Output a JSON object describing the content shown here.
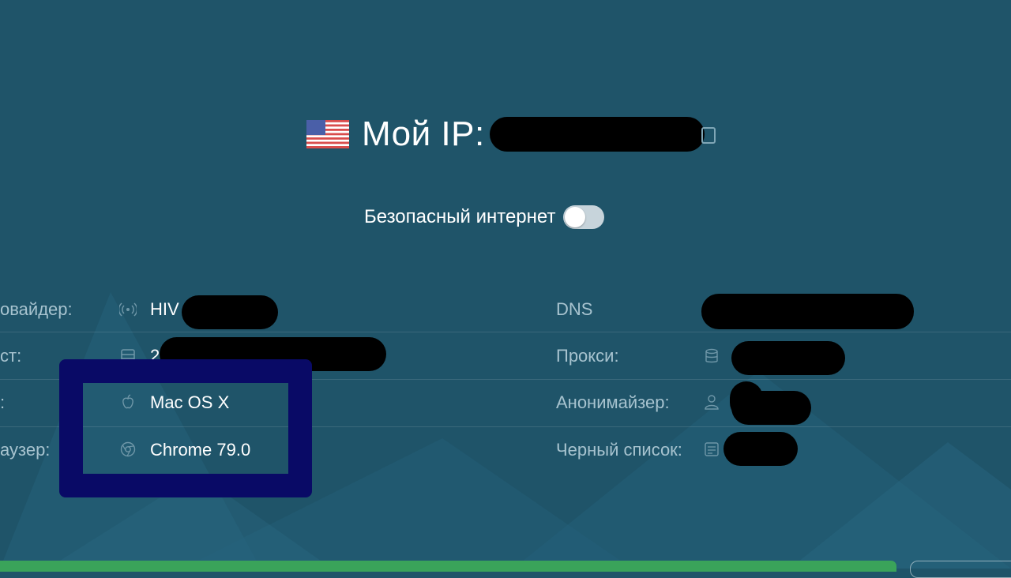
{
  "header": {
    "title": "Мой IP:"
  },
  "safe_internet": {
    "label": "Безопасный интернет",
    "enabled": false
  },
  "left_rows": [
    {
      "label": "овайдер:",
      "value": "HIV",
      "icon": "antenna-icon"
    },
    {
      "label": "ст:",
      "value": "2",
      "icon": "server-icon"
    },
    {
      "label": ":",
      "value": "Mac OS X",
      "icon": "apple-icon"
    },
    {
      "label": "аузер:",
      "value": "Chrome 79.0",
      "icon": "chrome-icon"
    }
  ],
  "right_rows": [
    {
      "label": "DNS",
      "icon": ""
    },
    {
      "label": "Прокси:",
      "icon": "database-icon"
    },
    {
      "label": "Анонимайзер:",
      "icon": "user-badge-icon"
    },
    {
      "label": "Черный список:",
      "icon": "list-icon"
    }
  ],
  "colors": {
    "background": "#1f5469",
    "label": "#a7c3cf",
    "highlight_border": "#090a66",
    "bottom_bar": "#3aa35a"
  }
}
